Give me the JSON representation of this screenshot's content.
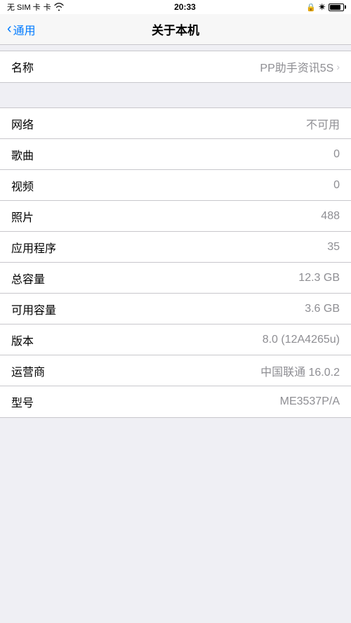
{
  "statusBar": {
    "carrier": "无 SIM 卡",
    "wifi": "wifi",
    "time": "20:33",
    "lock": "🔒",
    "bluetooth": "✴",
    "battery": "battery"
  },
  "navBar": {
    "backLabel": "通用",
    "title": "关于本机"
  },
  "rows": [
    {
      "label": "名称",
      "value": "PP助手资讯5S",
      "hasChevron": true
    },
    {
      "label": "网络",
      "value": "不可用",
      "hasChevron": false
    },
    {
      "label": "歌曲",
      "value": "0",
      "hasChevron": false
    },
    {
      "label": "视频",
      "value": "0",
      "hasChevron": false
    },
    {
      "label": "照片",
      "value": "488",
      "hasChevron": false
    },
    {
      "label": "应用程序",
      "value": "35",
      "hasChevron": false
    },
    {
      "label": "总容量",
      "value": "12.3 GB",
      "hasChevron": false
    },
    {
      "label": "可用容量",
      "value": "3.6 GB",
      "hasChevron": false
    },
    {
      "label": "版本",
      "value": "8.0 (12A4265u)",
      "hasChevron": false
    },
    {
      "label": "运营商",
      "value": "中国联通 16.0.2",
      "hasChevron": false
    },
    {
      "label": "型号",
      "value": "ME3537P/A",
      "hasChevron": false
    }
  ]
}
